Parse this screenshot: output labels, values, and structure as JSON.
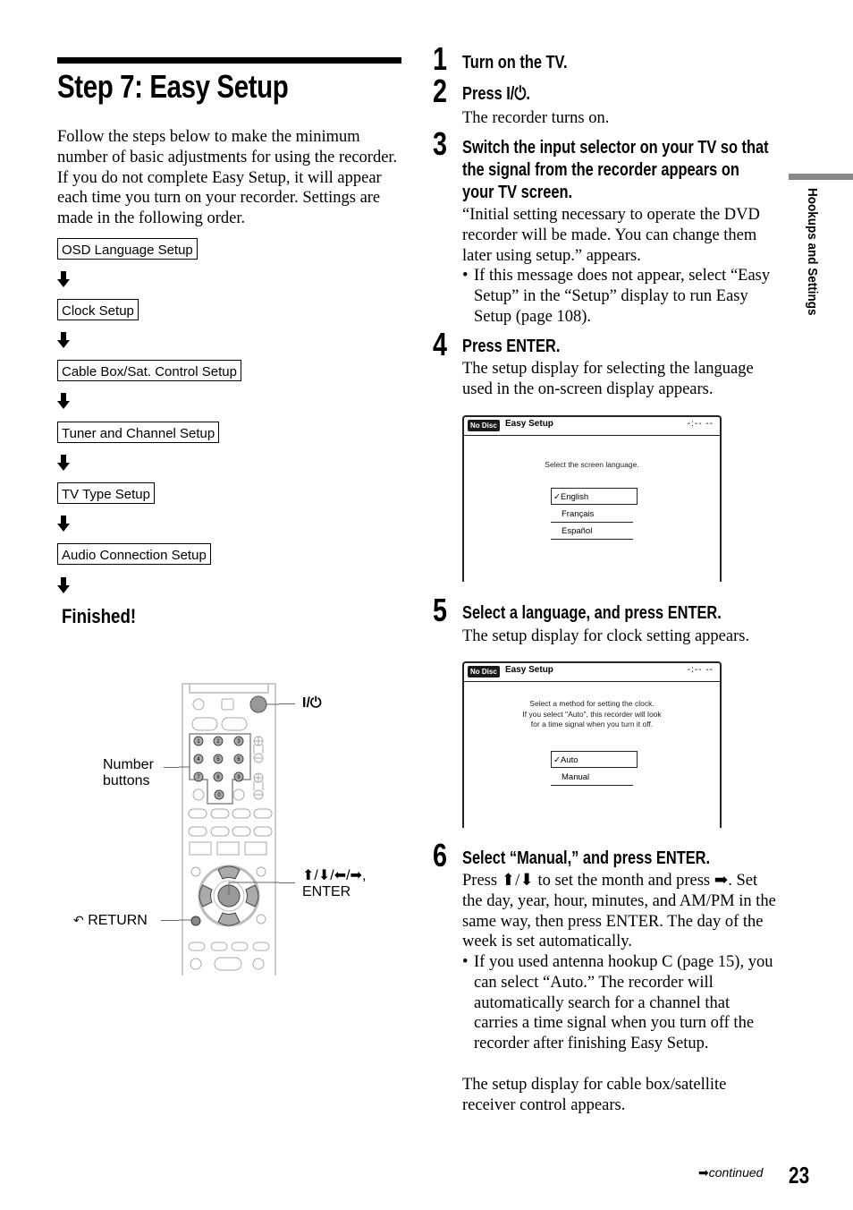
{
  "page": {
    "title": "Step 7: Easy Setup",
    "intro": "Follow the steps below to make the minimum number of basic adjustments for using the recorder. If you do not complete Easy Setup, it will appear each time you turn on your recorder. Settings are made in the following order.",
    "flow": [
      "OSD Language Setup",
      "Clock Setup",
      "Cable Box/Sat. Control Setup",
      "Tuner and Channel Setup",
      "TV Type Setup",
      "Audio Connection Setup"
    ],
    "finished": "Finished!",
    "side_tab": "Hookups and Settings",
    "continued": "continued",
    "page_number": "23"
  },
  "remote": {
    "power_label": "I/⏻",
    "number_buttons_label_1": "Number",
    "number_buttons_label_2": "buttons",
    "arrows_label_1": "⬆/⬇/⬅/➡,",
    "arrows_label_2": "ENTER",
    "return_label": "RETURN",
    "digits": [
      "1",
      "2",
      "3",
      "4",
      "5",
      "6",
      "7",
      "8",
      "9",
      "0"
    ]
  },
  "steps": [
    {
      "num": "1",
      "heading": "Turn on the TV."
    },
    {
      "num": "2",
      "heading": "Press I/⏻.",
      "body": "The recorder turns on."
    },
    {
      "num": "3",
      "heading_lines": [
        "Switch the input selector on your TV so that",
        "the signal from the recorder appears on",
        "your TV screen."
      ],
      "body": "“Initial setting necessary to operate the DVD recorder will be made. You can change them later using setup.” appears.",
      "bullet": "If this message does not appear, select “Easy Setup” in the “Setup” display to run Easy Setup (page 108)."
    },
    {
      "num": "4",
      "heading": "Press ENTER.",
      "body": "The setup display for selecting the language used in the on-screen display appears."
    },
    {
      "num": "5",
      "heading": "Select a language, and press ENTER.",
      "body": "The setup display for clock setting appears."
    },
    {
      "num": "6",
      "heading": "Select “Manual,” and press ENTER.",
      "body": "Press ⬆/⬇ to set the month and press ➡. Set the day, year, hour, minutes, and AM/PM in the same way, then press ENTER. The day of the week is set automatically.",
      "bullet": "If you used antenna hookup C (page 15), you can select “Auto.” The recorder will automatically search for a channel that carries a time signal when you turn off the recorder after finishing Easy Setup.",
      "after": "The setup display for cable box/satellite receiver control appears."
    }
  ],
  "osd_language": {
    "badge": "No Disc",
    "title": "Easy Setup",
    "time": "-:-- --",
    "message": "Select the screen language.",
    "options": [
      "English",
      "Français",
      "Español"
    ],
    "selected": "English",
    "check": "✓"
  },
  "osd_clock": {
    "badge": "No Disc",
    "title": "Easy Setup",
    "time": "-:-- --",
    "message_lines": [
      "Select a method for setting the clock.",
      "If you select \"Auto\", this recorder will look",
      "for a time signal when you turn it off."
    ],
    "options": [
      "Auto",
      "Manual"
    ],
    "selected": "Auto",
    "check": "✓"
  }
}
